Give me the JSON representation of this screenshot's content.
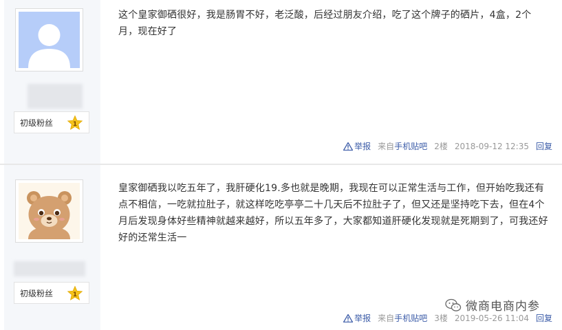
{
  "posts": [
    {
      "rank_label": "初级粉丝",
      "rank_level": "1",
      "content": "这个皇家御硒很好，我是肠胃不好，老泛酸，后经过朋友介绍，吃了这个牌子的硒片，4盒，2个月，现在好了",
      "report_label": "举报",
      "source_prefix": "来自",
      "source_app": "手机贴吧",
      "floor": "2楼",
      "time": "2018-09-12 12:35",
      "reply_label": "回复"
    },
    {
      "rank_label": "初级粉丝",
      "rank_level": "1",
      "content": "皇家御硒我以吃五年了，我肝硬化19.多也就是晚期，我现在可以正常生活与工作，但开始吃我还有点不相信，一吃就拉肚子，就这样吃吃亭亭二十几天后不拉肚子了，但又还是坚持吃下去，但在4个月后发现身体好些精神就越来越好，所以五年多了，大家都知道肝硬化发现就是死期到了，可我还好好的还常生活一",
      "report_label": "举报",
      "source_prefix": "来自",
      "source_app": "手机贴吧",
      "floor": "3楼",
      "time": "2019-05-26 11:04",
      "reply_label": "回复"
    }
  ],
  "watermark": "微商电商内参",
  "colors": {
    "link": "#3c5ca8",
    "meta": "#999999",
    "sidebar": "#f5f7fa",
    "star": "#f5c21b"
  }
}
